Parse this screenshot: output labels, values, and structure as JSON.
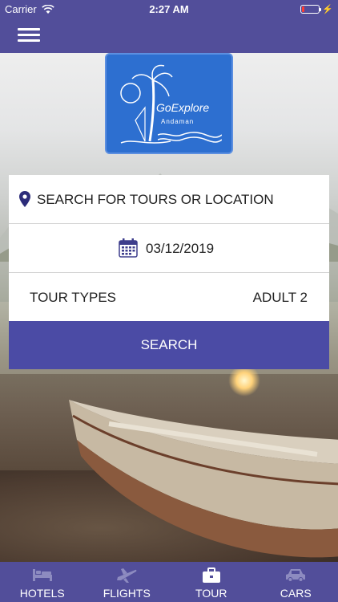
{
  "status": {
    "carrier": "Carrier",
    "time": "2:27 AM",
    "battery_level": 0.15
  },
  "nav": {
    "menu_icon": "hamburger-menu-icon"
  },
  "logo": {
    "brand": "GoExplore",
    "sub": "Andaman"
  },
  "search": {
    "location_placeholder": "SEARCH FOR TOURS OR LOCATION",
    "location_icon": "map-pin-icon",
    "date": "03/12/2019",
    "date_icon": "calendar-icon",
    "tour_types": "TOUR TYPES",
    "adults": "ADULT 2",
    "button_label": "SEARCH"
  },
  "tabs": [
    {
      "label": "HOTELS",
      "icon": "bed-icon",
      "active": false
    },
    {
      "label": "FLIGHTS",
      "icon": "airplane-icon",
      "active": false
    },
    {
      "label": "TOUR",
      "icon": "briefcase-icon",
      "active": true
    },
    {
      "label": "CARS",
      "icon": "car-icon",
      "active": false
    }
  ],
  "colors": {
    "brand_purple": "#524e9a",
    "button_blue": "#4b4ba5",
    "logo_blue": "#2d6fd0"
  }
}
